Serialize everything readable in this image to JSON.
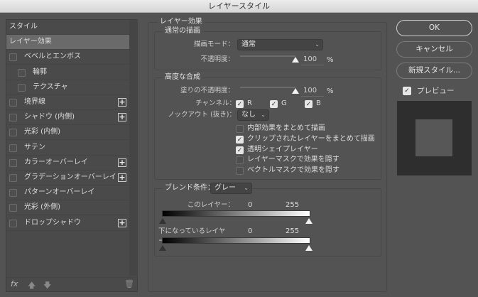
{
  "window": {
    "title": "レイヤースタイル"
  },
  "sidebar": {
    "items": [
      {
        "label": "スタイル",
        "checkbox": false,
        "plus": false,
        "selected": false
      },
      {
        "label": "レイヤー効果",
        "checkbox": false,
        "plus": false,
        "selected": true
      },
      {
        "label": "ベベルとエンボス",
        "checkbox": true,
        "plus": false,
        "indent": false
      },
      {
        "label": "輪郭",
        "checkbox": true,
        "plus": false,
        "indent": true
      },
      {
        "label": "テクスチャ",
        "checkbox": true,
        "plus": false,
        "indent": true
      },
      {
        "label": "境界線",
        "checkbox": true,
        "plus": true
      },
      {
        "label": "シャドウ (内側)",
        "checkbox": true,
        "plus": true
      },
      {
        "label": "光彩 (内側)",
        "checkbox": true,
        "plus": false
      },
      {
        "label": "サテン",
        "checkbox": true,
        "plus": false
      },
      {
        "label": "カラーオーバーレイ",
        "checkbox": true,
        "plus": true
      },
      {
        "label": "グラデーションオーバーレイ",
        "checkbox": true,
        "plus": true
      },
      {
        "label": "パターンオーバーレイ",
        "checkbox": true,
        "plus": false
      },
      {
        "label": "光彩 (外側)",
        "checkbox": true,
        "plus": false
      },
      {
        "label": "ドロップシャドウ",
        "checkbox": true,
        "plus": true
      }
    ],
    "toolbar": {
      "fx": "fx",
      "up": "🡅",
      "down": "🡇",
      "trash": "🗑"
    }
  },
  "main": {
    "title": "レイヤー効果",
    "normal": {
      "title": "通常の描画",
      "blend_mode_label": "描画モード：",
      "blend_mode": "通常",
      "opacity_label": "不透明度：",
      "opacity": "100",
      "percent": "%"
    },
    "advanced": {
      "title": "高度な合成",
      "fill_label": "塗りの不透明度：",
      "fill": "100",
      "percent": "%",
      "channels_label": "チャンネル：",
      "r": "R",
      "g": "G",
      "b": "B",
      "knockout_label": "ノックアウト (抜き)：",
      "knockout": "なし",
      "options": [
        {
          "label": "内部効果をまとめて描画",
          "checked": false
        },
        {
          "label": "クリップされたレイヤーをまとめて描画",
          "checked": true
        },
        {
          "label": "透明シェイプレイヤー",
          "checked": true
        },
        {
          "label": "レイヤーマスクで効果を隠す",
          "checked": false
        },
        {
          "label": "ベクトルマスクで効果を隠す",
          "checked": false
        }
      ]
    },
    "blendif": {
      "label": "ブレンド条件：",
      "value": "グレー",
      "this_layer_label": "このレイヤー：",
      "this_min": "0",
      "this_max": "255",
      "under_label": "下になっているレイヤー：",
      "under_min": "0",
      "under_max": "255"
    }
  },
  "right": {
    "ok": "OK",
    "cancel": "キャンセル",
    "new_style": "新規スタイル...",
    "preview_label": "プレビュー",
    "preview_checked": true
  },
  "colors": {
    "background": "#535353",
    "panel": "#4a4a4a",
    "selected": "#6a6a6a"
  }
}
